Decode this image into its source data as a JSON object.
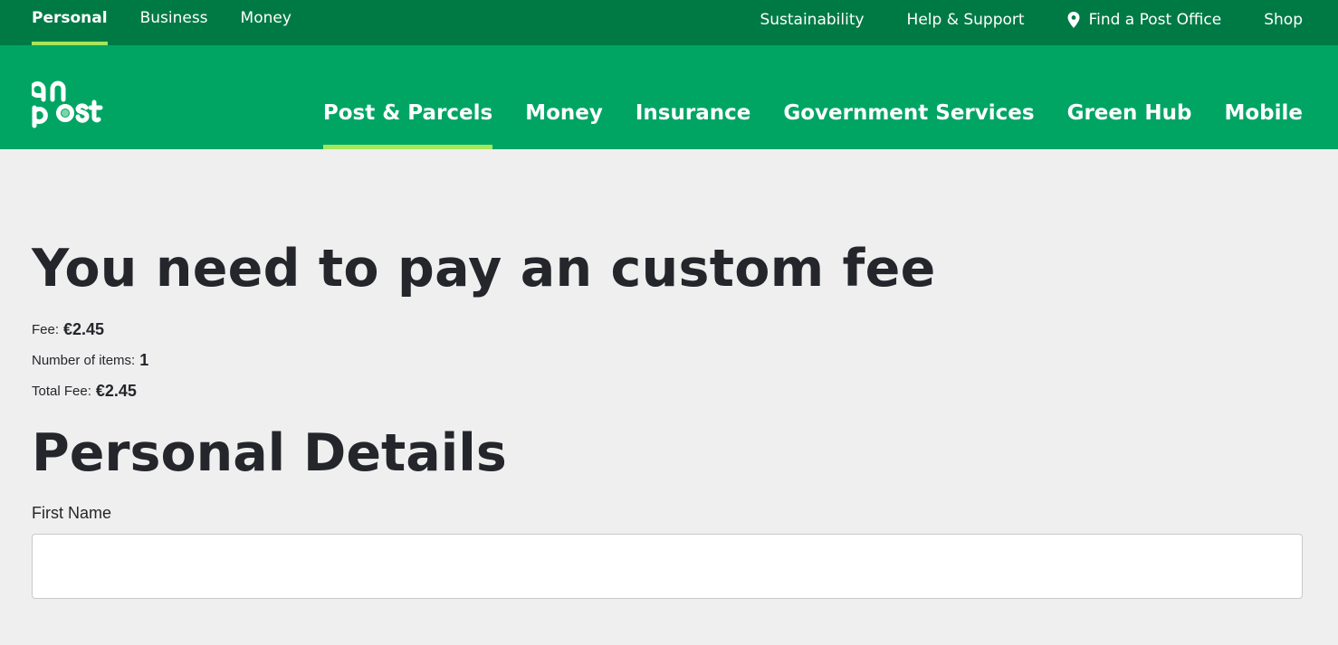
{
  "topbar": {
    "left_tabs": [
      {
        "label": "Personal",
        "active": true
      },
      {
        "label": "Business",
        "active": false
      },
      {
        "label": "Money",
        "active": false
      }
    ],
    "right_links": [
      {
        "label": "Sustainability"
      },
      {
        "label": "Help & Support"
      },
      {
        "label": "Find a Post Office",
        "icon": "map-pin-icon"
      },
      {
        "label": "Shop"
      }
    ]
  },
  "header": {
    "logo_alt": "an post",
    "nav": [
      {
        "label": "Post & Parcels",
        "active": true
      },
      {
        "label": "Money",
        "active": false
      },
      {
        "label": "Insurance",
        "active": false
      },
      {
        "label": "Government Services",
        "active": false
      },
      {
        "label": "Green Hub",
        "active": false
      },
      {
        "label": "Mobile",
        "active": false
      }
    ]
  },
  "main": {
    "title": "You need to pay an custom fee",
    "fees": [
      {
        "label": "Fee:",
        "value": "€2.45"
      },
      {
        "label": "Number of items:",
        "value": "1"
      },
      {
        "label": "Total Fee:",
        "value": "€2.45"
      }
    ],
    "section_title": "Personal Details",
    "form": {
      "first_name_label": "First Name",
      "first_name_value": "",
      "first_name_placeholder": ""
    }
  },
  "colors": {
    "topbar_bg": "#007a45",
    "header_bg": "#00a564",
    "active_underline": "#a6e65a",
    "page_bg": "#efefef",
    "text": "#24262b"
  }
}
